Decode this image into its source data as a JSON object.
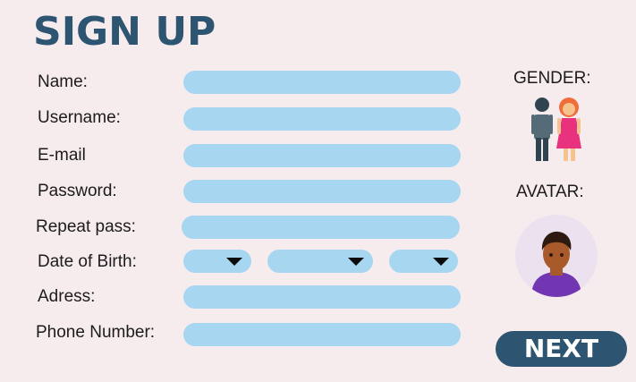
{
  "title": "SIGN UP",
  "form": {
    "name_label": "Name:",
    "username_label": "Username:",
    "email_label": "E-mail",
    "password_label": "Password:",
    "repeat_label": "Repeat pass:",
    "dob_label": "Date of Birth:",
    "address_label": "Adress:",
    "phone_label": "Phone Number:"
  },
  "side": {
    "gender_label": "GENDER:",
    "avatar_label": "AVATAR:"
  },
  "icons": {
    "gender": "male-female-icon",
    "avatar": "person-avatar-icon",
    "dropdown": "caret-down-icon"
  },
  "colors": {
    "background": "#f6eced",
    "title": "#2d5470",
    "field": "#a7d7f0",
    "button": "#2d5470"
  },
  "next_label": "NEXT"
}
